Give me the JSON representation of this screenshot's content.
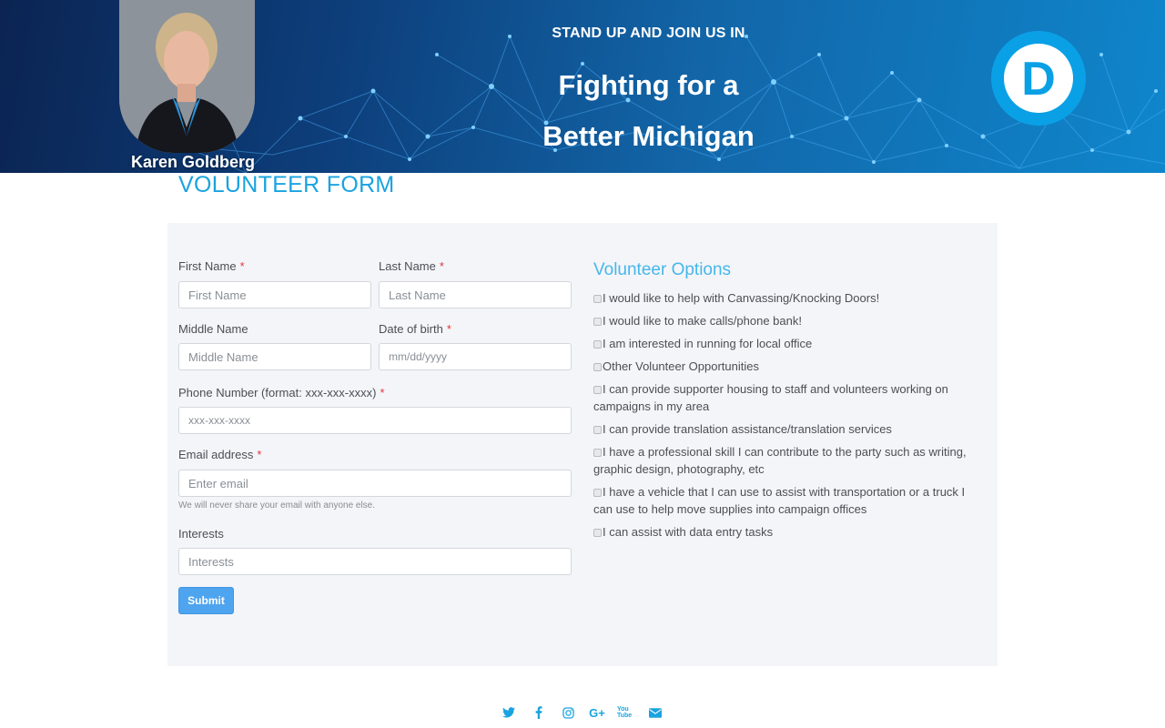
{
  "banner": {
    "candidate_name": "Karen Goldberg",
    "tagline": "STAND UP AND JOIN US IN",
    "headline_line1": "Fighting for a",
    "headline_line2": "Better Michigan",
    "logo_letter": "D",
    "logo_color": "#0aa0e6",
    "logo_icon": "democrat-d-logo-icon",
    "portrait_icon": "candidate-portrait"
  },
  "page": {
    "title": "VOLUNTEER FORM"
  },
  "form": {
    "first_name": {
      "label": "First Name",
      "required": "*",
      "placeholder": "First Name"
    },
    "last_name": {
      "label": "Last Name",
      "required": "*",
      "placeholder": "Last Name"
    },
    "middle_name": {
      "label": "Middle Name",
      "placeholder": "Middle Name"
    },
    "dob": {
      "label": "Date of birth",
      "required": "*",
      "placeholder": "mm/dd/yyyy"
    },
    "phone": {
      "label": "Phone Number (format: xxx-xxx-xxxx)",
      "required": "*",
      "placeholder": "xxx-xxx-xxxx"
    },
    "email": {
      "label": "Email address",
      "required": "*",
      "placeholder": "Enter email",
      "help": "We will never share your email with anyone else."
    },
    "interests": {
      "label": "Interests",
      "placeholder": "Interests"
    },
    "submit_label": "Submit"
  },
  "options": {
    "title": "Volunteer Options",
    "items": [
      "I would like to help with Canvassing/Knocking Doors!",
      "I would like to make calls/phone bank!",
      "I am interested in running for local office",
      "Other Volunteer Opportunities",
      "I can provide supporter housing to staff and volunteers working on campaigns in my area",
      "I can provide translation assistance/translation services",
      "I have a professional skill I can contribute to the party such as writing, graphic design, photography, etc",
      "I have a vehicle that I can use to assist with transportation or a truck I can use to help move supplies into campaign offices",
      "I can assist with data entry tasks"
    ]
  },
  "colors": {
    "accent": "#1aa3e0",
    "options_title": "#46b7ea",
    "button": "#4ea4ef",
    "required": "#e0383e",
    "panel_bg": "#f4f5f9"
  },
  "footer": {
    "social": [
      "twitter-icon",
      "facebook-icon",
      "instagram-icon",
      "google-plus-icon",
      "youtube-icon",
      "email-icon"
    ],
    "youtube_text": "You Tube",
    "google_text": "G+"
  }
}
